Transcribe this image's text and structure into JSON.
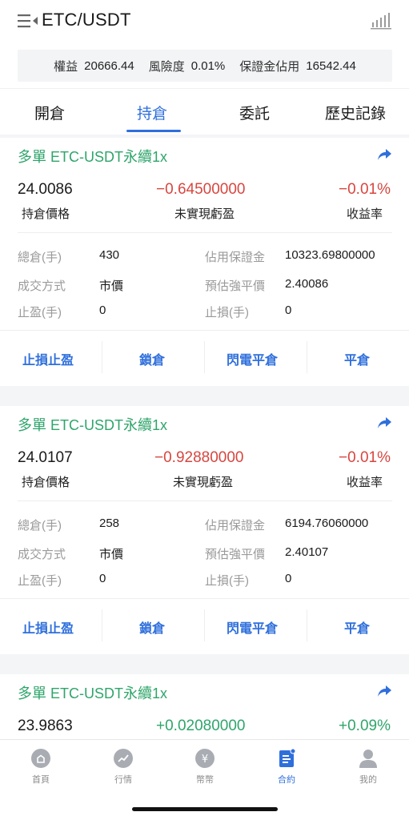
{
  "header": {
    "title": "ETC/USDT",
    "menu_icon": "menu-collapse-icon",
    "chart_icon": "bar-chart-icon"
  },
  "summary": {
    "equity_label": "權益",
    "equity_value": "20666.44",
    "risk_label": "風險度",
    "risk_value": "0.01%",
    "margin_label": "保證金佔用",
    "margin_value": "16542.44"
  },
  "tabs": [
    {
      "label": "開倉"
    },
    {
      "label": "持倉"
    },
    {
      "label": "委託"
    },
    {
      "label": "歷史記錄"
    }
  ],
  "active_tab": "持倉",
  "colors": {
    "accent": "#2f6fdc",
    "long": "#2fa56b",
    "loss": "#d7463f",
    "profit": "#2fa56b"
  },
  "positions": [
    {
      "title": "多單 ETC-USDT永續1x",
      "price": "24.0086",
      "price_label": "持倉價格",
      "pnl": "−0.64500000",
      "pnl_label": "未實現虧盈",
      "roi": "−0.01%",
      "roi_label": "收益率",
      "total_label": "總倉(手)",
      "total_value": "430",
      "margin_label": "佔用保證金",
      "margin_value": "10323.69800000",
      "order_type_label": "成交方式",
      "order_type_value": "市價",
      "liq_label": "預估強平價",
      "liq_value": "2.40086",
      "tp_label": "止盈(手)",
      "tp_value": "0",
      "sl_label": "止損(手)",
      "sl_value": "0"
    },
    {
      "title": "多單 ETC-USDT永續1x",
      "price": "24.0107",
      "price_label": "持倉價格",
      "pnl": "−0.92880000",
      "pnl_label": "未實現虧盈",
      "roi": "−0.01%",
      "roi_label": "收益率",
      "total_label": "總倉(手)",
      "total_value": "258",
      "margin_label": "佔用保證金",
      "margin_value": "6194.76060000",
      "order_type_label": "成交方式",
      "order_type_value": "市價",
      "liq_label": "預估強平價",
      "liq_value": "2.40107",
      "tp_label": "止盈(手)",
      "tp_value": "0",
      "sl_label": "止損(手)",
      "sl_value": "0"
    },
    {
      "title": "多單 ETC-USDT永續1x",
      "price": "23.9863",
      "pnl": "+0.02080000",
      "roi": "+0.09%"
    }
  ],
  "actions": {
    "stop_loss_take_profit": "止損止盈",
    "lock": "鎖倉",
    "flash_close": "閃電平倉",
    "close": "平倉"
  },
  "nav": [
    {
      "label": "首頁",
      "icon": "home-icon"
    },
    {
      "label": "行情",
      "icon": "market-trend-icon"
    },
    {
      "label": "幣幣",
      "icon": "yen-coin-icon"
    },
    {
      "label": "合約",
      "icon": "contract-document-icon"
    },
    {
      "label": "我的",
      "icon": "user-profile-icon"
    }
  ],
  "active_nav": "合約"
}
